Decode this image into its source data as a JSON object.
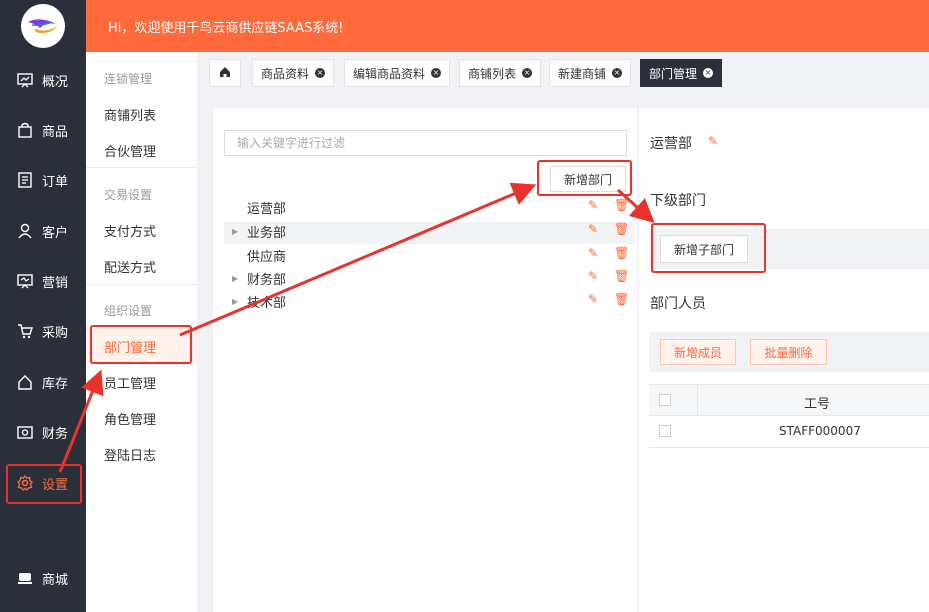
{
  "header": {
    "greeting": "Hi，欢迎使用千鸟云商供应链SAAS系统!"
  },
  "nav": {
    "items": [
      {
        "label": "概况",
        "icon": "dashboard-icon"
      },
      {
        "label": "商品",
        "icon": "bag-icon"
      },
      {
        "label": "订单",
        "icon": "order-icon"
      },
      {
        "label": "客户",
        "icon": "user-icon"
      },
      {
        "label": "营销",
        "icon": "marketing-icon"
      },
      {
        "label": "采购",
        "icon": "cart-icon"
      },
      {
        "label": "库存",
        "icon": "home-icon"
      },
      {
        "label": "财务",
        "icon": "finance-icon"
      },
      {
        "label": "设置",
        "icon": "gear-icon"
      }
    ],
    "bottom": {
      "label": "商城",
      "icon": "shop-icon"
    }
  },
  "subnav": {
    "group1": "连锁管理",
    "group1_items": [
      "商铺列表",
      "合伙管理"
    ],
    "group2": "交易设置",
    "group2_items": [
      "支付方式",
      "配送方式"
    ],
    "group3": "组织设置",
    "group3_items": [
      "部门管理",
      "员工管理",
      "角色管理",
      "登陆日志"
    ]
  },
  "tabs": [
    "商品资料",
    "编辑商品资料",
    "商铺列表",
    "新建商铺",
    "部门管理"
  ],
  "left": {
    "search_placeholder": "输入关键字进行过滤",
    "add_dept": "新增部门",
    "tree": [
      "运营部",
      "业务部",
      "供应商",
      "财务部",
      "技术部"
    ]
  },
  "right": {
    "dept_name": "运营部",
    "sub_title": "下级部门",
    "add_sub": "新增子部门",
    "members_title": "部门人员",
    "add_member": "新增成员",
    "batch_delete": "批量删除",
    "col_staff_no": "工号",
    "staff_no": "STAFF000007"
  },
  "colors": {
    "accent": "#ff6a3d",
    "sidebar": "#2b2f3a",
    "annotation": "#e8332c"
  }
}
